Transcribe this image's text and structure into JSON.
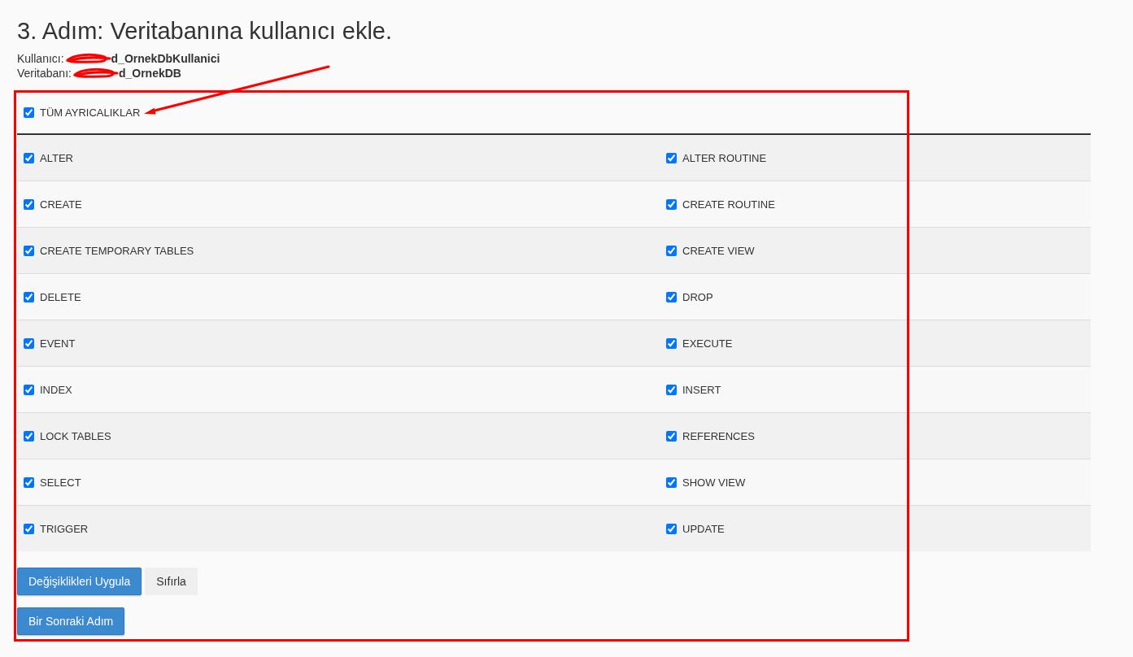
{
  "heading": "3. Adım: Veritabanına kullanıcı ekle.",
  "details": [
    {
      "label": "Kullanıcı:",
      "value": "d_OrnekDbKullanici",
      "redacted": true
    },
    {
      "label": "Veritabanı:",
      "value": "d_OrnekDB",
      "redacted": true
    }
  ],
  "all_privileges": {
    "label": "TÜM AYRICALIKLAR",
    "checked": true
  },
  "privilege_rows": [
    [
      {
        "label": "ALTER",
        "checked": true
      },
      {
        "label": "ALTER ROUTINE",
        "checked": true
      }
    ],
    [
      {
        "label": "CREATE",
        "checked": true
      },
      {
        "label": "CREATE ROUTINE",
        "checked": true
      }
    ],
    [
      {
        "label": "CREATE TEMPORARY TABLES",
        "checked": true
      },
      {
        "label": "CREATE VIEW",
        "checked": true
      }
    ],
    [
      {
        "label": "DELETE",
        "checked": true
      },
      {
        "label": "DROP",
        "checked": true
      }
    ],
    [
      {
        "label": "EVENT",
        "checked": true
      },
      {
        "label": "EXECUTE",
        "checked": true
      }
    ],
    [
      {
        "label": "INDEX",
        "checked": true
      },
      {
        "label": "INSERT",
        "checked": true
      }
    ],
    [
      {
        "label": "LOCK TABLES",
        "checked": true
      },
      {
        "label": "REFERENCES",
        "checked": true
      }
    ],
    [
      {
        "label": "SELECT",
        "checked": true
      },
      {
        "label": "SHOW VIEW",
        "checked": true
      }
    ],
    [
      {
        "label": "TRIGGER",
        "checked": true
      },
      {
        "label": "UPDATE",
        "checked": true
      }
    ]
  ],
  "buttons": [
    {
      "label": "Değişiklikleri Uygula",
      "kind": "primary"
    },
    {
      "label": "Sıfırla",
      "kind": "reset"
    }
  ],
  "next_button": {
    "label": "Bir Sonraki Adım",
    "kind": "primary"
  }
}
